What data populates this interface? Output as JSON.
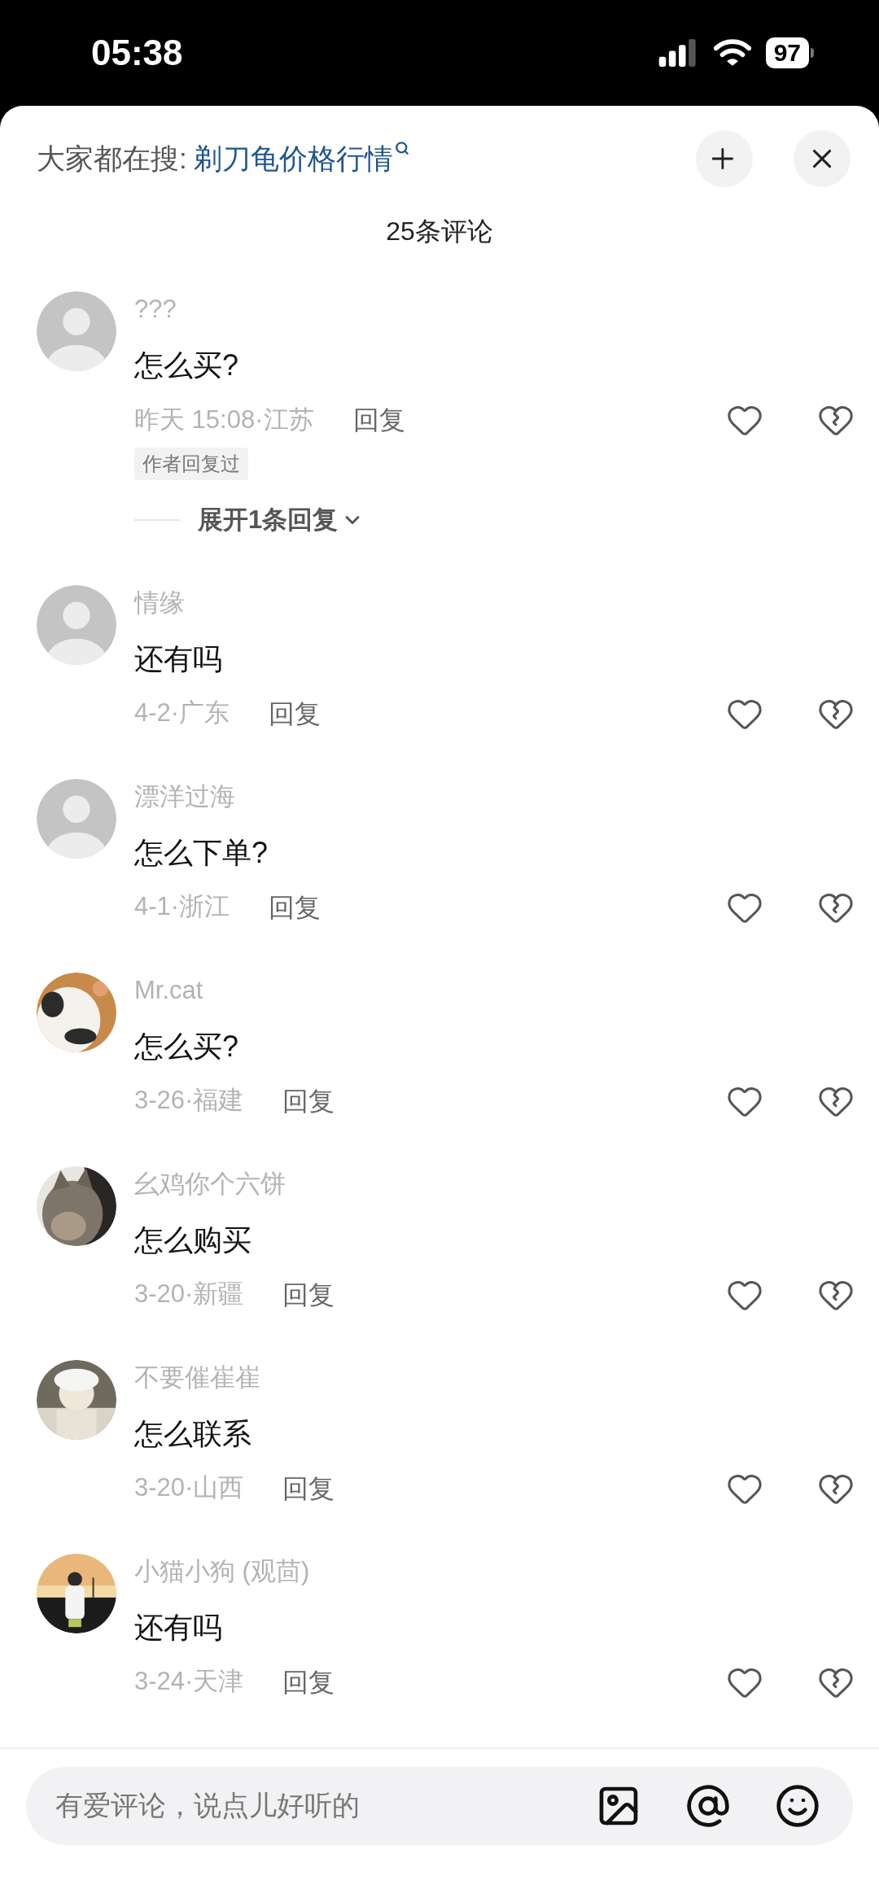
{
  "status_bar": {
    "time": "05:38",
    "battery": "97"
  },
  "header": {
    "search_prompt": "大家都在搜:",
    "search_term": "剃刀龟价格行情"
  },
  "comment_count": "25条评论",
  "comments": [
    {
      "user": "???",
      "avatar": {
        "kind": "default"
      },
      "text": "怎么买?",
      "meta": "昨天 15:08·江苏",
      "reply": "回复",
      "author_replied": "作者回复过",
      "expand": "展开1条回复"
    },
    {
      "user": "情缘",
      "avatar": {
        "kind": "default"
      },
      "text": "还有吗",
      "meta": "4-2·广东",
      "reply": "回复"
    },
    {
      "user": "漂洋过海",
      "avatar": {
        "kind": "default"
      },
      "text": "怎么下单?",
      "meta": "4-1·浙江",
      "reply": "回复"
    },
    {
      "user": "Mr.cat",
      "text": "怎么买?",
      "meta": "3-26·福建",
      "reply": "回复"
    },
    {
      "user": "幺鸡你个六饼",
      "text": "怎么购买",
      "meta": "3-20·新疆",
      "reply": "回复"
    },
    {
      "user": "不要催崔崔",
      "text": "怎么联系",
      "meta": "3-20·山西",
      "reply": "回复"
    },
    {
      "user": "小猫小狗 (观茴)",
      "text": "还有吗",
      "meta": "3-24·天津",
      "reply": "回复"
    }
  ],
  "input": {
    "placeholder": "有爱评论，说点儿好听的"
  }
}
